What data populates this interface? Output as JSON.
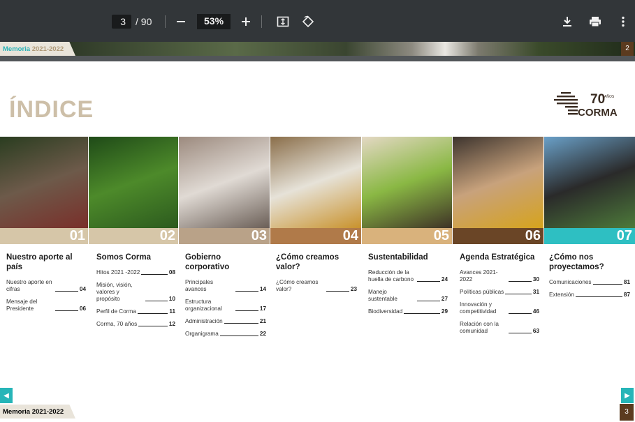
{
  "toolbar": {
    "current_page": "3",
    "total_pages": "/ 90",
    "zoom": "53%",
    "icons": [
      "minus-icon",
      "plus-icon",
      "fit-page-icon",
      "rotate-icon",
      "download-icon",
      "print-icon",
      "more-vertical-icon"
    ]
  },
  "prev_page": {
    "tag_a": "Memoria",
    "tag_b": "2021-2022",
    "page_number": "2"
  },
  "page": {
    "title": "ÍNDICE",
    "logo_text": "CORMA",
    "logo_years": "70",
    "logo_years_suffix": "AÑOS",
    "tiles": [
      {
        "num": "01",
        "bar_color": "#d6c6a8",
        "photo": [
          "#2a3d20",
          "#6d5a4a",
          "#7a2f2a"
        ]
      },
      {
        "num": "02",
        "bar_color": "#d6c6a8",
        "photo": [
          "#1f4a18",
          "#4d8a2a",
          "#2c5a1e"
        ]
      },
      {
        "num": "03",
        "bar_color": "#b9a288",
        "photo": [
          "#9c8a7e",
          "#e0dad4",
          "#6a5e56"
        ]
      },
      {
        "num": "04",
        "bar_color": "#b07a49",
        "photo": [
          "#8a6e4a",
          "#e6e2d8",
          "#c9922c"
        ]
      },
      {
        "num": "05",
        "bar_color": "#d9b27c",
        "photo": [
          "#e4d8c4",
          "#8ab844",
          "#3e3226"
        ]
      },
      {
        "num": "06",
        "bar_color": "#6a4526",
        "photo": [
          "#3d342e",
          "#c8a27c",
          "#d6a31c"
        ]
      },
      {
        "num": "07",
        "bar_color": "#2ebfc2",
        "photo": [
          "#6aa0c8",
          "#2a2a2a",
          "#4d7a3a"
        ]
      }
    ],
    "sections": [
      {
        "title": "Nuestro aporte al país",
        "entries": [
          {
            "label": "Nuestro aporte en cifras",
            "page": "04"
          },
          {
            "label": "Mensaje del Presidente",
            "page": "06"
          }
        ]
      },
      {
        "title": "Somos Corma",
        "entries": [
          {
            "label": "Hitos 2021 -2022",
            "page": "08"
          },
          {
            "label": "Misión, visión, valores y propósito",
            "page": "10"
          },
          {
            "label": "Perfil de Corma",
            "page": "11"
          },
          {
            "label": "Corma, 70 años",
            "page": "12"
          }
        ]
      },
      {
        "title": "Gobierno corporativo",
        "entries": [
          {
            "label": "Principales avances",
            "page": "14"
          },
          {
            "label": "Estructura organizacional",
            "page": "17"
          },
          {
            "label": "Administración",
            "page": "21"
          },
          {
            "label": "Organigrama",
            "page": "22"
          }
        ]
      },
      {
        "title": "¿Cómo creamos valor?",
        "entries": [
          {
            "label": "¿Cómo creamos valor?",
            "page": "23"
          }
        ]
      },
      {
        "title": "Sustentabilidad",
        "entries": [
          {
            "label": "Reducción de la huella de carbono",
            "page": "24"
          },
          {
            "label": "Manejo sustentable",
            "page": "27"
          },
          {
            "label": "Biodiversidad",
            "page": "29"
          }
        ]
      },
      {
        "title": "Agenda Estratégica",
        "entries": [
          {
            "label": "Avances 2021-2022",
            "page": "30"
          },
          {
            "label": "Políticas públicas",
            "page": "31"
          },
          {
            "label": "Innovación y competitividad",
            "page": "46"
          },
          {
            "label": "Relación con la comunidad",
            "page": "63"
          }
        ]
      },
      {
        "title": "¿Cómo nos proyectamos?",
        "entries": [
          {
            "label": "Comunicaciones",
            "page": "81"
          },
          {
            "label": "Extensión",
            "page": "87"
          }
        ]
      }
    ],
    "footer_tag_a": "Memoria",
    "footer_tag_b": "2021-2022",
    "page_number": "3"
  }
}
